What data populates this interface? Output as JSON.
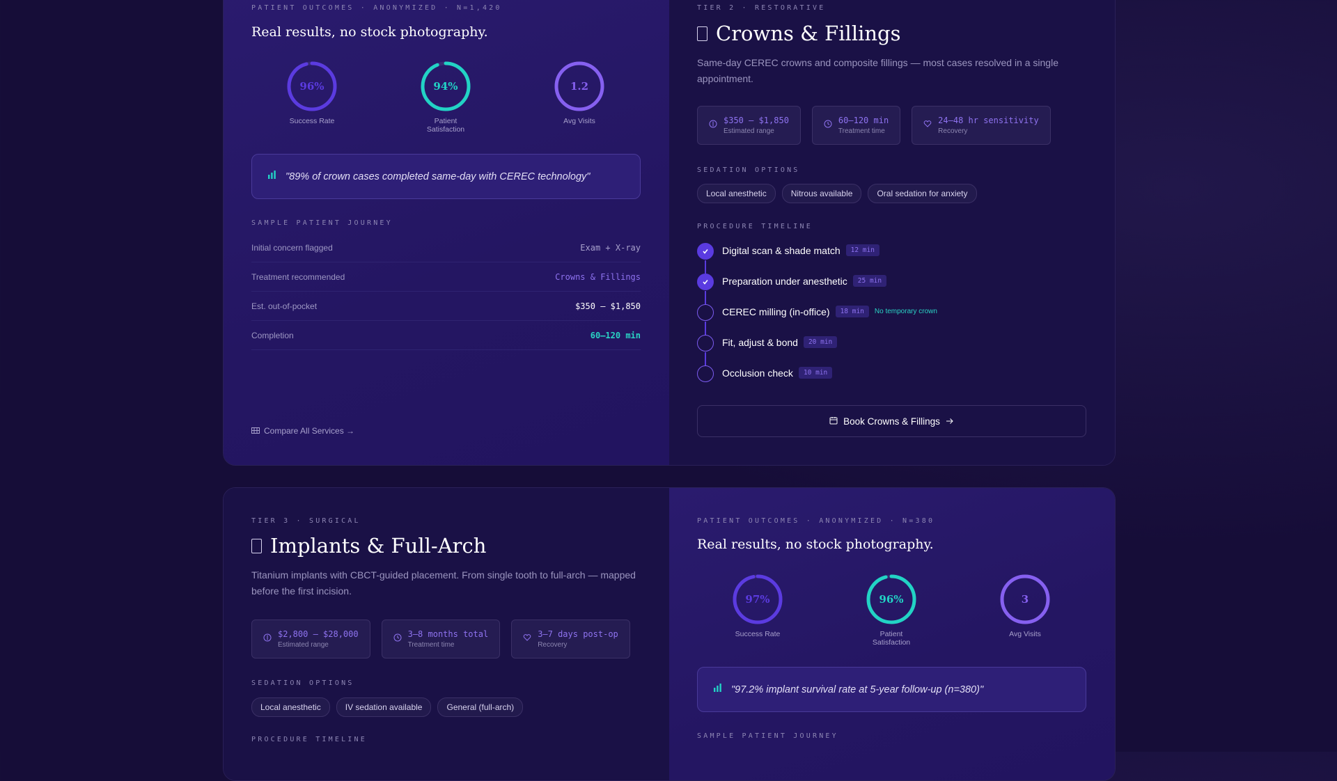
{
  "card1": {
    "outcomes": {
      "eyebrow": "PATIENT OUTCOMES · ANONYMIZED · N=1,420",
      "heading": "Real results, no stock photography.",
      "rings": [
        {
          "value": "96%",
          "label": "Success Rate",
          "fraction": 0.96,
          "color": "#5b3be0"
        },
        {
          "value": "94%",
          "label": "Patient Satisfaction",
          "fraction": 0.94,
          "color": "#22d3c5"
        },
        {
          "value": "1.2",
          "label": "Avg Visits",
          "fraction": 1.0,
          "color": "#8660f0"
        }
      ],
      "quote": "\"89% of crown cases completed same-day with CEREC technology\"",
      "journey_title": "SAMPLE PATIENT JOURNEY",
      "journey": [
        {
          "key": "Initial concern flagged",
          "value": "Exam + X-ray",
          "color": "#a8a1cc"
        },
        {
          "key": "Treatment recommended",
          "value": "Crowns & Fillings",
          "color": "#8f73f0"
        },
        {
          "key": "Est. out-of-pocket",
          "value": "$350 – $1,850",
          "color": "#ffffff"
        },
        {
          "key": "Completion",
          "value": "60–120 min",
          "color": "#2ad3c4"
        }
      ],
      "compare_link": "Compare All Services →"
    },
    "service": {
      "eyebrow": "TIER 2 · RESTORATIVE",
      "title": "Crowns & Fillings",
      "description": "Same-day CEREC crowns and composite fillings — most cases resolved in a single appointment.",
      "stats": [
        {
          "icon": "dollar-icon",
          "value": "$350 – $1,850",
          "label": "Estimated range"
        },
        {
          "icon": "clock-icon",
          "value": "60–120 min",
          "label": "Treatment time"
        },
        {
          "icon": "heart-icon",
          "value": "24–48 hr sensitivity",
          "label": "Recovery"
        }
      ],
      "sedation_title": "SEDATION OPTIONS",
      "sedation": [
        "Local anesthetic",
        "Nitrous available",
        "Oral sedation for anxiety"
      ],
      "timeline_title": "PROCEDURE TIMELINE",
      "timeline": [
        {
          "name": "Digital scan & shade match",
          "duration": "12 min",
          "done": true,
          "note": ""
        },
        {
          "name": "Preparation under anesthetic",
          "duration": "25 min",
          "done": true,
          "note": ""
        },
        {
          "name": "CEREC milling (in-office)",
          "duration": "18 min",
          "done": false,
          "note": "No temporary crown"
        },
        {
          "name": "Fit, adjust & bond",
          "duration": "20 min",
          "done": false,
          "note": ""
        },
        {
          "name": "Occlusion check",
          "duration": "10 min",
          "done": false,
          "note": ""
        }
      ],
      "book_label": "Book Crowns & Fillings"
    }
  },
  "card2": {
    "service": {
      "eyebrow": "TIER 3 · SURGICAL",
      "title": "Implants & Full-Arch",
      "description": "Titanium implants with CBCT-guided placement. From single tooth to full-arch — mapped before the first incision.",
      "stats": [
        {
          "icon": "dollar-icon",
          "value": "$2,800 – $28,000",
          "label": "Estimated range"
        },
        {
          "icon": "clock-icon",
          "value": "3–8 months total",
          "label": "Treatment time"
        },
        {
          "icon": "heart-icon",
          "value": "3–7 days post-op",
          "label": "Recovery"
        }
      ],
      "sedation_title": "SEDATION OPTIONS",
      "sedation": [
        "Local anesthetic",
        "IV sedation available",
        "General (full-arch)"
      ],
      "timeline_title": "PROCEDURE TIMELINE"
    },
    "outcomes": {
      "eyebrow": "PATIENT OUTCOMES · ANONYMIZED · N=380",
      "heading": "Real results, no stock photography.",
      "rings": [
        {
          "value": "97%",
          "label": "Success Rate",
          "fraction": 0.97,
          "color": "#5b3be0"
        },
        {
          "value": "96%",
          "label": "Patient Satisfaction",
          "fraction": 0.96,
          "color": "#22d3c5"
        },
        {
          "value": "3",
          "label": "Avg Visits",
          "fraction": 1.0,
          "color": "#8660f0"
        }
      ],
      "quote": "\"97.2% implant survival rate at 5-year follow-up (n=380)\"",
      "journey_title": "SAMPLE PATIENT JOURNEY"
    }
  }
}
